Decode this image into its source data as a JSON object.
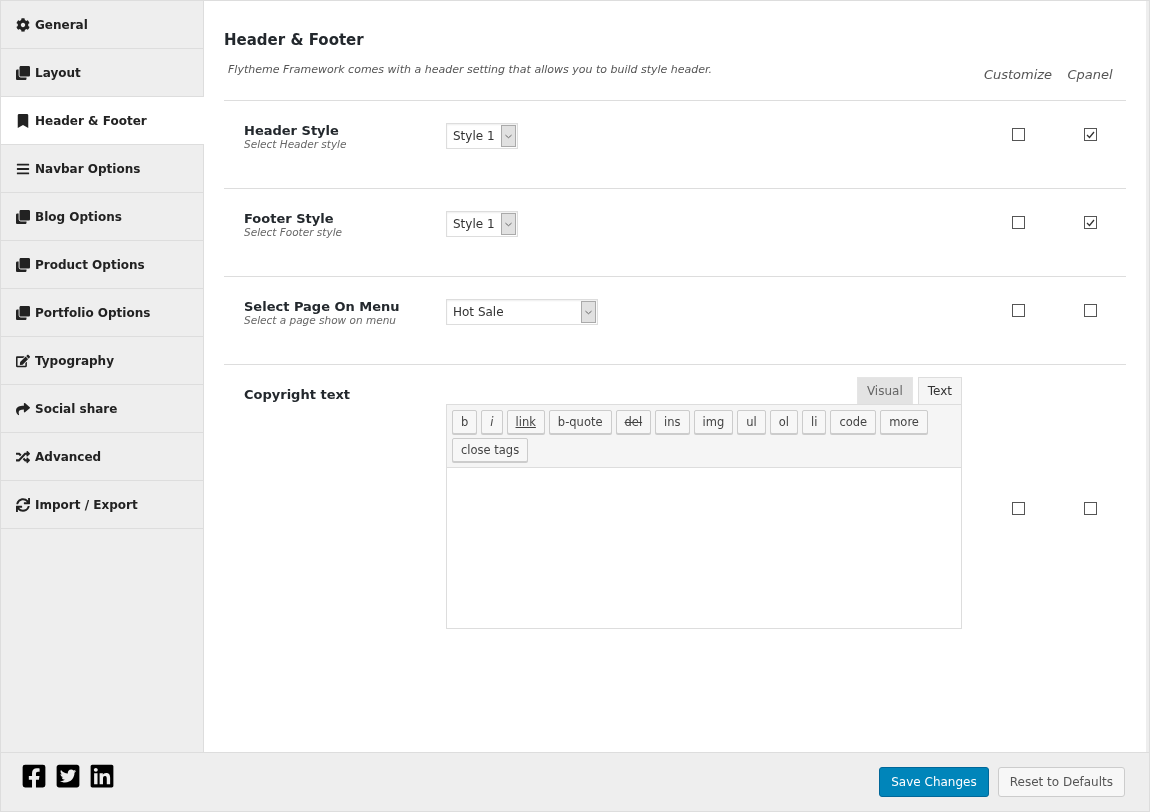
{
  "sidebar": {
    "items": [
      {
        "label": "General",
        "kind": "gear",
        "selected": false
      },
      {
        "label": "Layout",
        "kind": "copy",
        "selected": false
      },
      {
        "label": "Header & Footer",
        "kind": "bookmark",
        "selected": true
      },
      {
        "label": "Navbar Options",
        "kind": "bars",
        "selected": false
      },
      {
        "label": "Blog Options",
        "kind": "copy",
        "selected": false
      },
      {
        "label": "Product Options",
        "kind": "copy",
        "selected": false
      },
      {
        "label": "Portfolio Options",
        "kind": "copy",
        "selected": false
      },
      {
        "label": "Typography",
        "kind": "edit",
        "selected": false
      },
      {
        "label": "Social share",
        "kind": "share",
        "selected": false
      },
      {
        "label": "Advanced",
        "kind": "shuffle",
        "selected": false
      },
      {
        "label": "Import / Export",
        "kind": "refresh",
        "selected": false
      }
    ]
  },
  "section": {
    "title": "Header & Footer",
    "description": "Flytheme Framework comes with a header setting that allows you to build style header.",
    "columns": [
      "Customize",
      "Cpanel"
    ]
  },
  "rows": [
    {
      "kind": "select",
      "label": "Header Style",
      "hint": "Select Header style",
      "value": "Style 1",
      "customize": false,
      "cpanel": true
    },
    {
      "kind": "select",
      "label": "Footer Style",
      "hint": "Select Footer style",
      "value": "Style 1",
      "customize": false,
      "cpanel": true
    },
    {
      "kind": "wideselect",
      "label": "Select Page On Menu",
      "hint": "Select a page show on menu",
      "value": "Hot Sale",
      "customize": false,
      "cpanel": false
    },
    {
      "kind": "editor",
      "label": "Copyright text",
      "customize": false,
      "cpanel": false,
      "tabs": [
        {
          "label": "Visual",
          "selected": false
        },
        {
          "label": "Text",
          "selected": true
        }
      ],
      "buttons": [
        {
          "label": "b",
          "kind": "bold"
        },
        {
          "label": "i",
          "kind": "italic"
        },
        {
          "label": "link",
          "kind": "underline"
        },
        {
          "label": "b-quote",
          "kind": "plain"
        },
        {
          "label": "del",
          "kind": "strike"
        },
        {
          "label": "ins",
          "kind": "plain"
        },
        {
          "label": "img",
          "kind": "plain"
        },
        {
          "label": "ul",
          "kind": "plain"
        },
        {
          "label": "ol",
          "kind": "plain"
        },
        {
          "label": "li",
          "kind": "plain"
        },
        {
          "label": "code",
          "kind": "plain"
        },
        {
          "label": "more",
          "kind": "plain"
        },
        {
          "label": "close tags",
          "kind": "plain"
        }
      ]
    }
  ],
  "footer": {
    "buttons": [
      {
        "label": "Save Changes",
        "kind": "primary"
      },
      {
        "label": "Reset to Defaults",
        "kind": "secondary"
      }
    ]
  }
}
